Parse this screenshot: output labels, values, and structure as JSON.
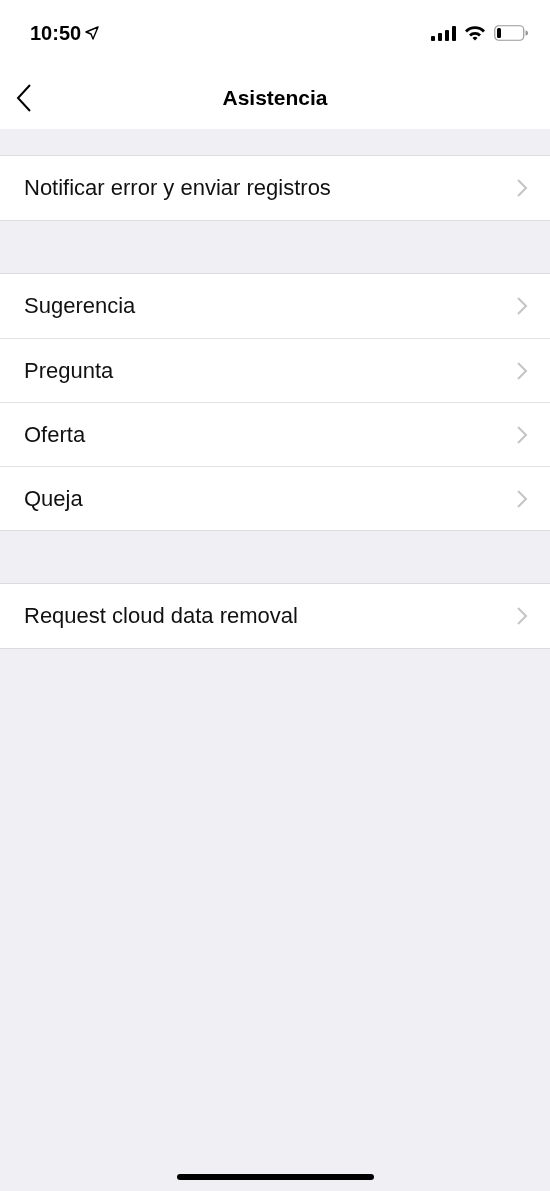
{
  "status_bar": {
    "time": "10:50"
  },
  "nav_bar": {
    "title": "Asistencia"
  },
  "sections": [
    {
      "items": [
        {
          "label": "Notificar error y enviar registros"
        }
      ]
    },
    {
      "items": [
        {
          "label": "Sugerencia"
        },
        {
          "label": "Pregunta"
        },
        {
          "label": "Oferta"
        },
        {
          "label": "Queja"
        }
      ]
    },
    {
      "items": [
        {
          "label": "Request cloud data removal"
        }
      ]
    }
  ]
}
